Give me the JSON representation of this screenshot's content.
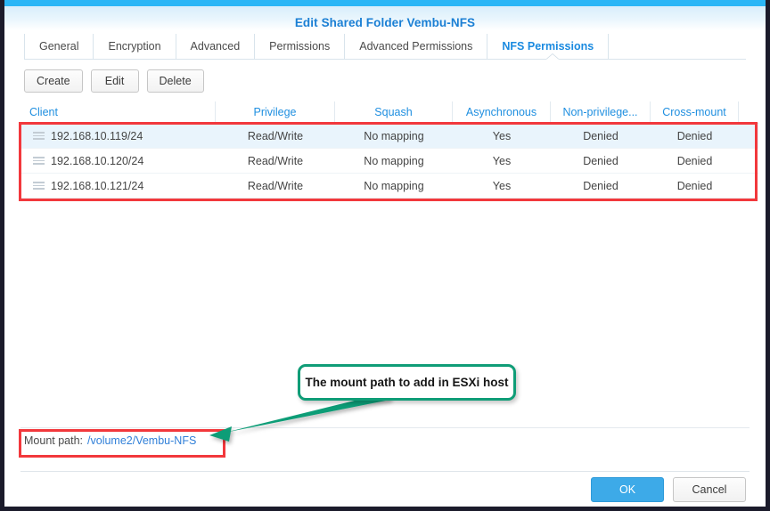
{
  "window": {
    "title": "Edit Shared Folder Vembu-NFS",
    "accent_blue": "#29b6f6",
    "title_color": "#1a7fd4",
    "highlight_red": "#f2383c",
    "callout_green": "#0f9d77"
  },
  "tabs": [
    {
      "label": "General",
      "active": false
    },
    {
      "label": "Encryption",
      "active": false
    },
    {
      "label": "Advanced",
      "active": false
    },
    {
      "label": "Permissions",
      "active": false
    },
    {
      "label": "Advanced Permissions",
      "active": false
    },
    {
      "label": "NFS Permissions",
      "active": true
    }
  ],
  "toolbar": {
    "create_label": "Create",
    "edit_label": "Edit",
    "delete_label": "Delete"
  },
  "table": {
    "columns": [
      "Client",
      "Privilege",
      "Squash",
      "Asynchronous",
      "Non-privilege...",
      "Cross-mount"
    ],
    "rows": [
      {
        "selected": true,
        "client": "192.168.10.119/24",
        "privilege": "Read/Write",
        "squash": "No mapping",
        "asynchronous": "Yes",
        "non_privilege": "Denied",
        "cross_mount": "Denied"
      },
      {
        "selected": false,
        "client": "192.168.10.120/24",
        "privilege": "Read/Write",
        "squash": "No mapping",
        "asynchronous": "Yes",
        "non_privilege": "Denied",
        "cross_mount": "Denied"
      },
      {
        "selected": false,
        "client": "192.168.10.121/24",
        "privilege": "Read/Write",
        "squash": "No mapping",
        "asynchronous": "Yes",
        "non_privilege": "Denied",
        "cross_mount": "Denied"
      }
    ]
  },
  "annotation": {
    "callout_text": "The mount path to add in ESXi host"
  },
  "mount_path": {
    "label": "Mount path:",
    "value": "/volume2/Vembu-NFS"
  },
  "footer": {
    "ok_label": "OK",
    "cancel_label": "Cancel"
  }
}
